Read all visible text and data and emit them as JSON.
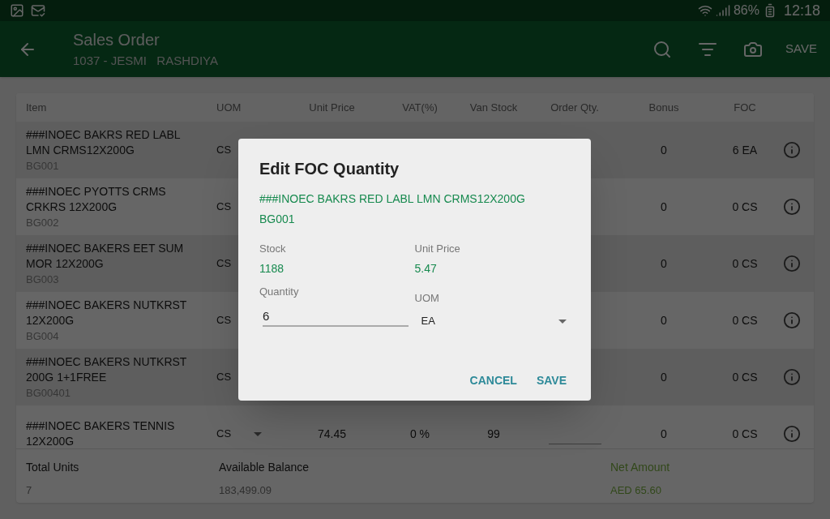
{
  "status_bar": {
    "battery": "86%",
    "time": "12:18"
  },
  "toolbar": {
    "title": "Sales Order",
    "subtitle": "1037 - JESMI   RASHDIYA",
    "action": "SAVE"
  },
  "table": {
    "columns": [
      "Item",
      "UOM",
      "Unit Price",
      "VAT(%)",
      "Van Stock",
      "Order Qty.",
      "Bonus",
      "FOC"
    ],
    "rows": [
      {
        "item": "###INOEC BAKRS RED LABL LMN CRMS12X200G",
        "code": "BG001",
        "uom": "CS",
        "bonus": "0",
        "foc": "6 EA"
      },
      {
        "item": "###INOEC PYOTTS CRMS CRKRS 12X200G",
        "code": "BG002",
        "uom": "CS",
        "bonus": "0",
        "foc": "0 CS"
      },
      {
        "item": "###INOEC BAKERS EET SUM MOR 12X200G",
        "code": "BG003",
        "uom": "CS",
        "bonus": "0",
        "foc": "0 CS"
      },
      {
        "item": "###INOEC BAKERS NUTKRST 12X200G",
        "code": "BG004",
        "uom": "CS",
        "bonus": "0",
        "foc": "0 CS"
      },
      {
        "item": "###INOEC BAKERS NUTKRST 200G 1+1FREE",
        "code": "BG00401",
        "uom": "CS",
        "bonus": "0",
        "foc": "0 CS"
      },
      {
        "item": "###INOEC BAKERS TENNIS 12X200G",
        "uom": "CS",
        "uom_caret": true,
        "unit_price": "74.45",
        "vat": "0 %",
        "van_stock": "99",
        "order_qty_field": true,
        "bonus": "0",
        "foc": "0 CS"
      }
    ]
  },
  "totals": [
    {
      "label": "Total Units",
      "value": "7",
      "kind": "plain"
    },
    {
      "label": "Available Balance",
      "value": "183,499.09",
      "kind": "plain"
    },
    {
      "label": "Net Amount",
      "value": "AED 65.60",
      "kind": "highlight"
    }
  ],
  "dialog": {
    "title": "Edit FOC Quantity",
    "item_name": "###INOEC BAKRS RED LABL LMN CRMS12X200G",
    "item_code": "BG001",
    "fields": [
      {
        "label": "Stock",
        "value": "1188"
      },
      {
        "label": "Unit Price",
        "value": "5.47"
      }
    ],
    "quantity": {
      "label": "Quantity",
      "value": "6"
    },
    "uom": {
      "label": "UOM",
      "value": "EA"
    },
    "buttons": [
      "CANCEL",
      "SAVE"
    ]
  }
}
